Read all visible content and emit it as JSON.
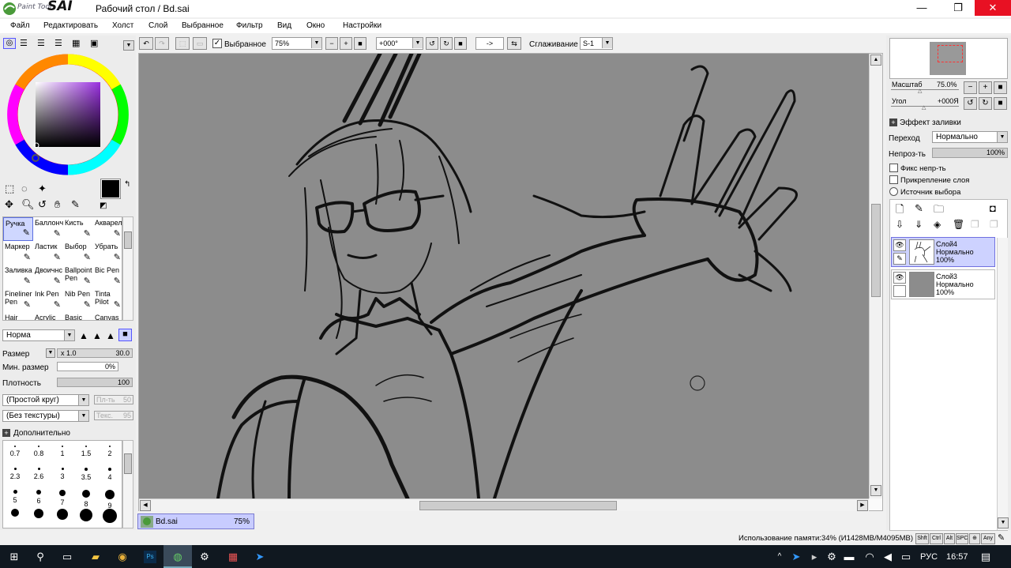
{
  "app": {
    "title": "Рабочий стол / Bd.sai",
    "logo_small": "Paint Tool",
    "logo_big": "SAI"
  },
  "window": {
    "minimize": "—",
    "maximize": "❐",
    "close": "✕"
  },
  "menu": [
    "Файл",
    "Редактировать",
    "Холст",
    "Слой",
    "Выбранное",
    "Фильтр",
    "Вид",
    "Окно",
    "Настройки"
  ],
  "toolbar": {
    "selection_checkbox": "Выбранное",
    "zoom": "75%",
    "angle": "+000°",
    "flip": "->",
    "smoothing_label": "Сглаживание",
    "smoothing_value": "S-1"
  },
  "tools": [
    {
      "label": "Ручка",
      "icon": "pen-icon"
    },
    {
      "label": "Баллонч",
      "icon": "airbrush-icon"
    },
    {
      "label": "Кисть",
      "icon": "brush-icon"
    },
    {
      "label": "Акварел",
      "icon": "watercolor-icon"
    },
    {
      "label": "Маркер",
      "icon": "marker-icon"
    },
    {
      "label": "Ластик",
      "icon": "eraser-icon"
    },
    {
      "label": "Выбор",
      "icon": "select-brush-icon"
    },
    {
      "label": "Убрать",
      "icon": "deselect-brush-icon"
    },
    {
      "label": "Заливка",
      "icon": "bucket-icon"
    },
    {
      "label": "Двоичнс",
      "icon": "binary-pen-icon"
    },
    {
      "label": "Ballpoint Pen",
      "icon": "ballpoint-icon"
    },
    {
      "label": "Bic Pen",
      "icon": "bic-pen-icon"
    },
    {
      "label": "Fineliner Pen",
      "icon": "fineliner-icon"
    },
    {
      "label": "Ink Pen",
      "icon": "ink-pen-icon"
    },
    {
      "label": "Nib Pen",
      "icon": "nib-pen-icon"
    },
    {
      "label": "Tinta Pilot",
      "icon": "tinta-icon"
    },
    {
      "label": "Hair",
      "icon": ""
    },
    {
      "label": "Acrylic",
      "icon": ""
    },
    {
      "label": "Basic",
      "icon": ""
    },
    {
      "label": "Canvas",
      "icon": ""
    }
  ],
  "brush": {
    "mode": "Норма",
    "size_label": "Размер",
    "size_mult": "x 1.0",
    "size_value": "30.0",
    "min_size_label": "Мин. размер",
    "min_size_value": "0%",
    "density_label": "Плотность",
    "density_value": "100",
    "shape": "(Простой круг)",
    "shape_param_label": "Пл-ть",
    "shape_param_value": "50",
    "texture": "(Без текстуры)",
    "texture_param_label": "Текс.",
    "texture_param_value": "95",
    "advanced_label": "Дополнительно"
  },
  "brush_sizes": [
    "0.7",
    "0.8",
    "1",
    "1.5",
    "2",
    "2.3",
    "2.6",
    "3",
    "3.5",
    "4",
    "5",
    "6",
    "7",
    "8",
    "9",
    "",
    "",
    "",
    "",
    ""
  ],
  "navigator": {
    "scale_label": "Масштаб",
    "scale_value": "75.0%",
    "angle_label": "Угол",
    "angle_value": "+000Я"
  },
  "layer_props": {
    "fill_effect": "Эффект заливки",
    "blend_label": "Переход",
    "blend_value": "Нормально",
    "opacity_label": "Непроз-ть",
    "opacity_value": "100%",
    "opacity_level": 1.0,
    "preserve_opacity": "Фикс непр-ть",
    "clip_layer": "Прикрепление слоя",
    "selection_source": "Источник выбора"
  },
  "layers": [
    {
      "name": "Слой4",
      "mode": "Нормально",
      "opacity": "100%",
      "selected": true
    },
    {
      "name": "Слой3",
      "mode": "Нормально",
      "opacity": "100%",
      "selected": false
    }
  ],
  "document_tab": {
    "name": "Bd.sai",
    "zoom": "75%"
  },
  "status": {
    "memory": "Использование памяти:34% (И1428MB/M4095MB)",
    "keys": [
      "Shft",
      "Ctrl",
      "Alt",
      "SPC",
      "",
      "Any"
    ]
  },
  "taskbar": {
    "lang": "РУС",
    "time": "16:57"
  },
  "colors": {
    "primary": "#000000",
    "secondary": "#808080",
    "selected_bg": "#cdd2ff",
    "canvas_bg": "#8c8c8c"
  }
}
